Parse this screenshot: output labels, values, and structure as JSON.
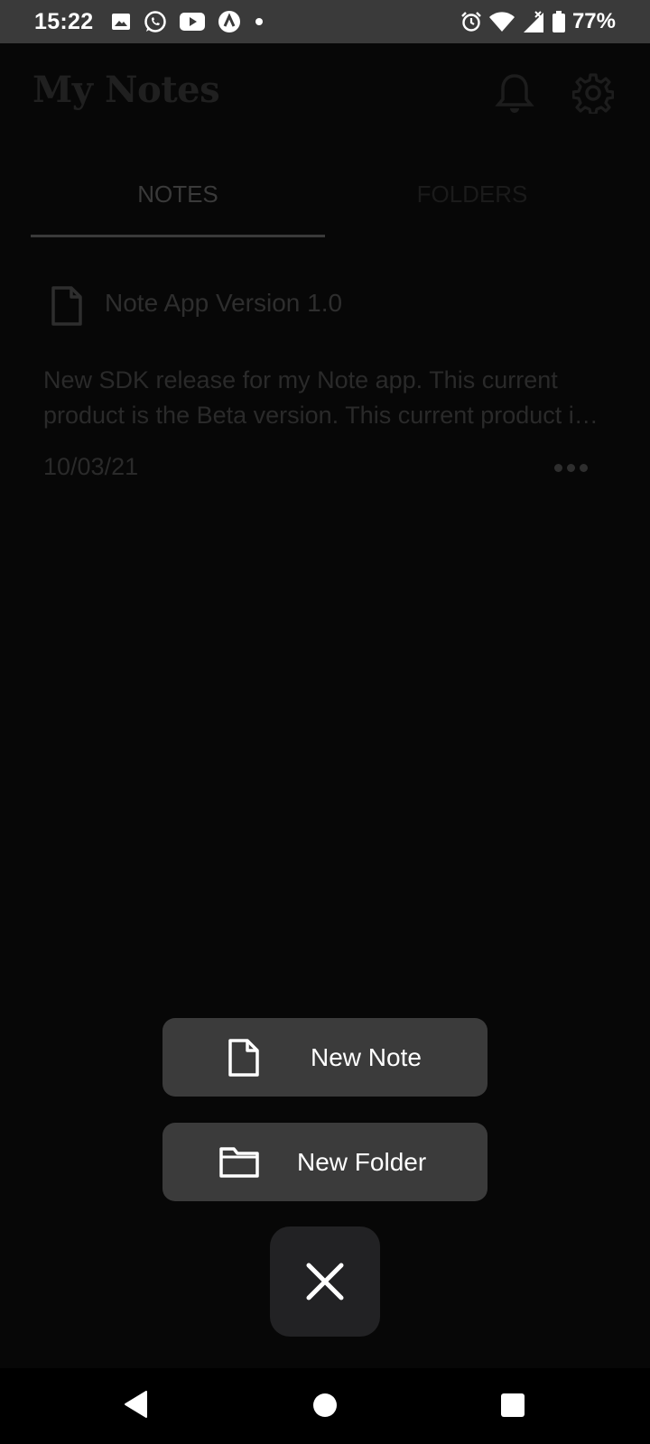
{
  "status_bar": {
    "time": "15:22",
    "left_icons": [
      "gallery-icon",
      "whatsapp-icon",
      "youtube-icon",
      "app-icon",
      "dot-icon"
    ],
    "right_icons": [
      "alarm-icon",
      "wifi-icon",
      "signal-icon",
      "battery-icon"
    ],
    "battery": "77%"
  },
  "header": {
    "title": "My Notes",
    "actions": [
      "bell-icon",
      "gear-icon"
    ]
  },
  "tabs": [
    {
      "label": "NOTES",
      "selected": true
    },
    {
      "label": "FOLDERS",
      "selected": false
    }
  ],
  "notes": [
    {
      "title": "Note App Version 1.0",
      "body": "New SDK release for my Note app. This current product is the Beta version. This current product is the Beta version.",
      "date": "10/03/21"
    }
  ],
  "fab_menu": {
    "new_note_label": "New Note",
    "new_folder_label": "New Folder",
    "close_icon": "close-icon"
  },
  "colors": {
    "background": "#070707",
    "fab_option_bg": "#3b3b3b",
    "fab_close_bg": "#222224",
    "status_bar_bg": "#3a3a3a"
  }
}
